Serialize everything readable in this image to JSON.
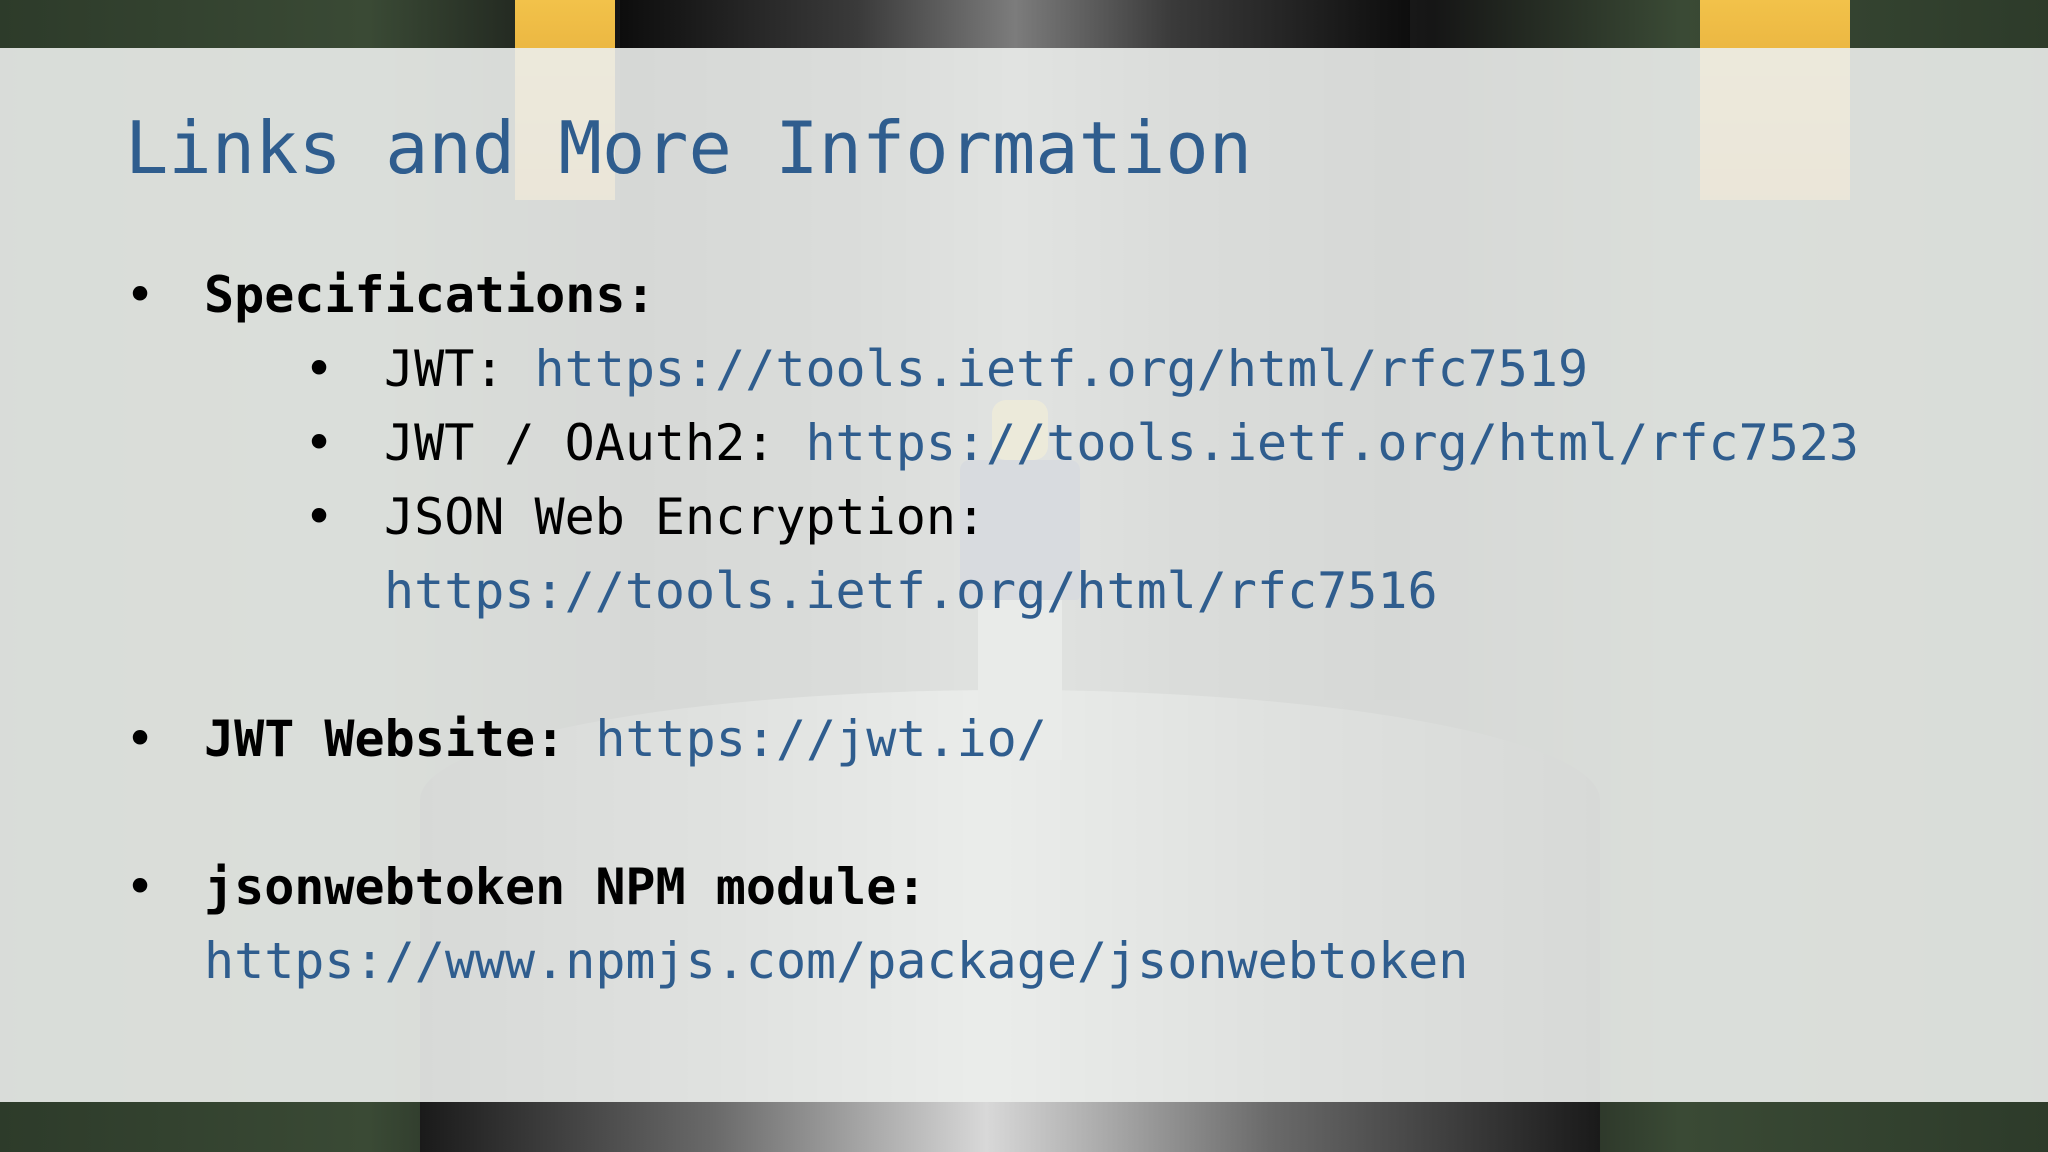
{
  "slide": {
    "title": "Links and More Information",
    "items": [
      {
        "label": "Specifications:",
        "children": [
          {
            "label": "JWT: ",
            "url": "https://tools.ietf.org/html/rfc7519"
          },
          {
            "label": "JWT / OAuth2: ",
            "url": "https://tools.ietf.org/html/rfc7523"
          },
          {
            "label": "JSON Web Encryption: ",
            "url": "https://tools.ietf.org/html/rfc7516"
          }
        ]
      },
      {
        "label": "JWT Website: ",
        "url": "https://jwt.io/"
      },
      {
        "label": "jsonwebtoken NPM module: ",
        "url": "https://www.npmjs.com/package/jsonwebtoken"
      }
    ]
  },
  "colors": {
    "title": "#2f5d8e",
    "link": "#2f5d8e",
    "text": "#000000",
    "panel": "#eceeec"
  }
}
